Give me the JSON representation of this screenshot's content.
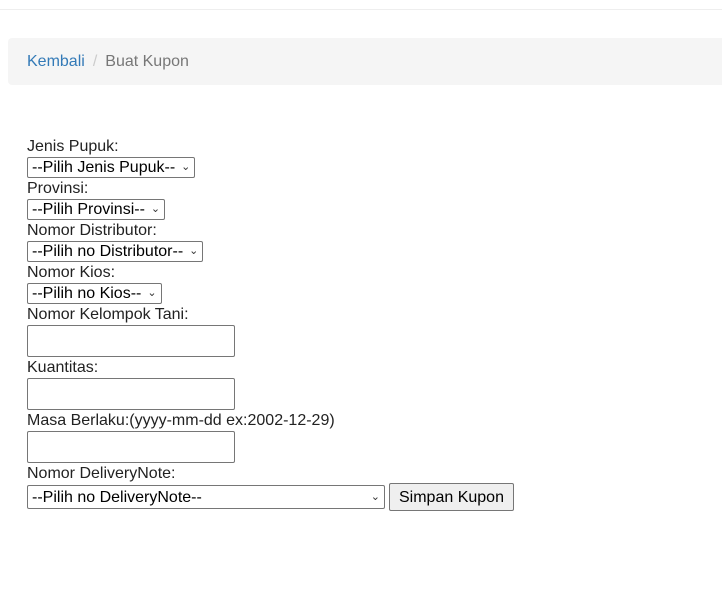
{
  "breadcrumb": {
    "back_label": "Kembali",
    "separator": "/",
    "current_label": "Buat Kupon"
  },
  "form": {
    "jenis_pupuk_label": "Jenis Pupuk:",
    "jenis_pupuk_value": "--Pilih Jenis Pupuk--",
    "provinsi_label": "Provinsi:",
    "provinsi_value": "--Pilih Provinsi--",
    "distributor_label": "Nomor Distributor:",
    "distributor_value": "--Pilih no Distributor--",
    "kios_label": "Nomor Kios:",
    "kios_value": "--Pilih no Kios--",
    "kelompok_tani_label": "Nomor Kelompok Tani:",
    "kelompok_tani_value": "",
    "kuantitas_label": "Kuantitas:",
    "kuantitas_value": "",
    "masa_berlaku_label": "Masa Berlaku:(yyyy-mm-dd ex:2002-12-29)",
    "masa_berlaku_value": "",
    "delivery_note_label": "Nomor DeliveryNote:",
    "delivery_note_value": "--Pilih no DeliveryNote--",
    "submit_label": "Simpan Kupon"
  },
  "icons": {
    "dropdown": "chevron-down-icon"
  }
}
